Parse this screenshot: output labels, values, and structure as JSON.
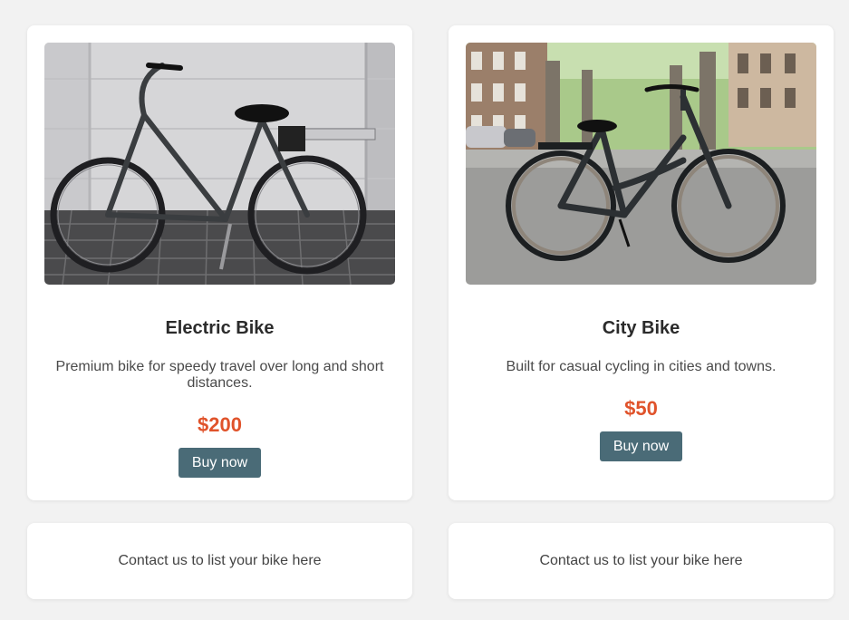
{
  "products": [
    {
      "image_alt": "Electric bike parked against a white garage door on paving stones",
      "title": "Electric Bike",
      "description": "Premium bike for speedy travel over long and short distances.",
      "price": "$200",
      "button_label": "Buy now"
    },
    {
      "image_alt": "Black city bike on a tree-lined street",
      "title": "City Bike",
      "description": "Built for casual cycling in cities and towns.",
      "price": "$50",
      "button_label": "Buy now"
    }
  ],
  "placeholders": [
    {
      "text": "Contact us to list your bike here"
    },
    {
      "text": "Contact us to list your bike here"
    }
  ],
  "colors": {
    "background": "#f2f2f2",
    "card": "#ffffff",
    "price": "#e0532b",
    "button": "#4a6b77"
  }
}
